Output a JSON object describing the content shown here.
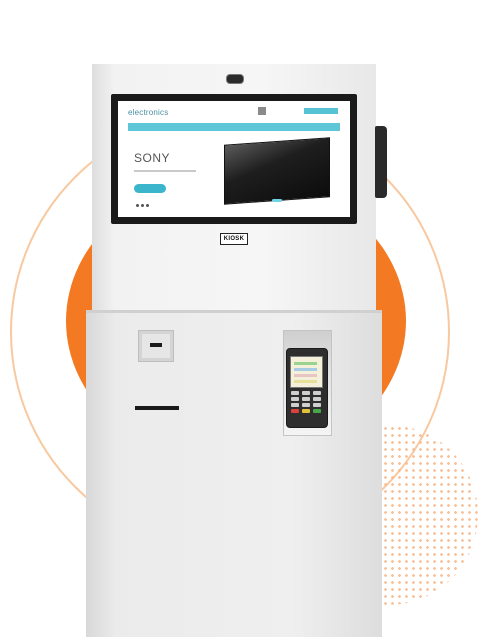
{
  "screen": {
    "logo_text": "electronics",
    "hero_brand": "SONY"
  },
  "kiosk": {
    "badge_label": "KIOSK"
  },
  "colors": {
    "accent_orange": "#f37a22",
    "ring_peach": "#f8c9a0",
    "screen_teal": "#5ec6d6",
    "screen_button": "#3bb5cc"
  },
  "icons": {
    "camera": "camera-icon",
    "card_reader": "card-reader-icon",
    "search": "search-icon",
    "cart": "cart-icon"
  }
}
